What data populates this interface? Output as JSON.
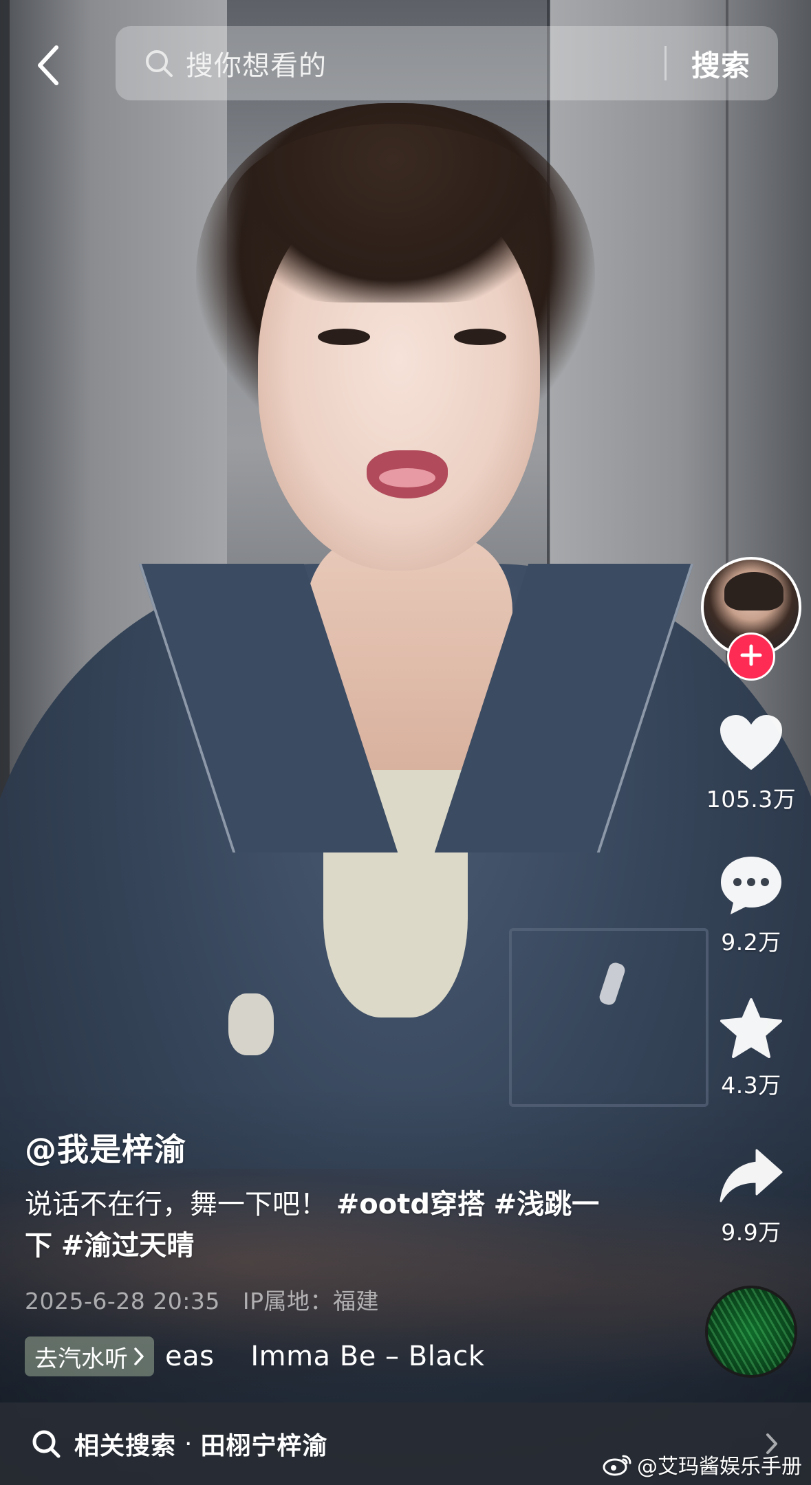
{
  "search": {
    "placeholder": "搜你想看的",
    "submit_label": "搜索"
  },
  "creator": {
    "handle": "@我是梓渝"
  },
  "actions": {
    "like_count": "105.3万",
    "comment_count": "9.2万",
    "favorite_count": "4.3万",
    "share_count": "9.9万"
  },
  "caption": {
    "text": "说话不在行，舞一下吧！",
    "hashtags": [
      "#ootd穿搭",
      "#浅跳一下",
      "#渝过天晴"
    ]
  },
  "meta": {
    "datetime": "2025-6-28 20:35",
    "ip_location": "IP属地：福建"
  },
  "music": {
    "app_button_label": "去汽水听",
    "title": "eas    Imma Be – Black"
  },
  "related_search": {
    "label": "相关搜索",
    "separator": "·",
    "term": "田栩宁梓渝"
  },
  "watermark": {
    "text": "@艾玛酱娱乐手册"
  },
  "icons": {
    "back": "chevron-left-icon",
    "search": "search-icon",
    "follow": "plus-icon",
    "like": "heart-icon",
    "comment": "comment-bubble-icon",
    "favorite": "star-icon",
    "share": "share-arrow-icon",
    "music_disc": "music-disc-icon",
    "related_chevron": "chevron-right-icon",
    "weibo": "weibo-logo-icon"
  },
  "colors": {
    "follow_accent": "#fe2c55",
    "text": "#ffffff",
    "meta_text": "rgba(255,255,255,0.6)"
  }
}
